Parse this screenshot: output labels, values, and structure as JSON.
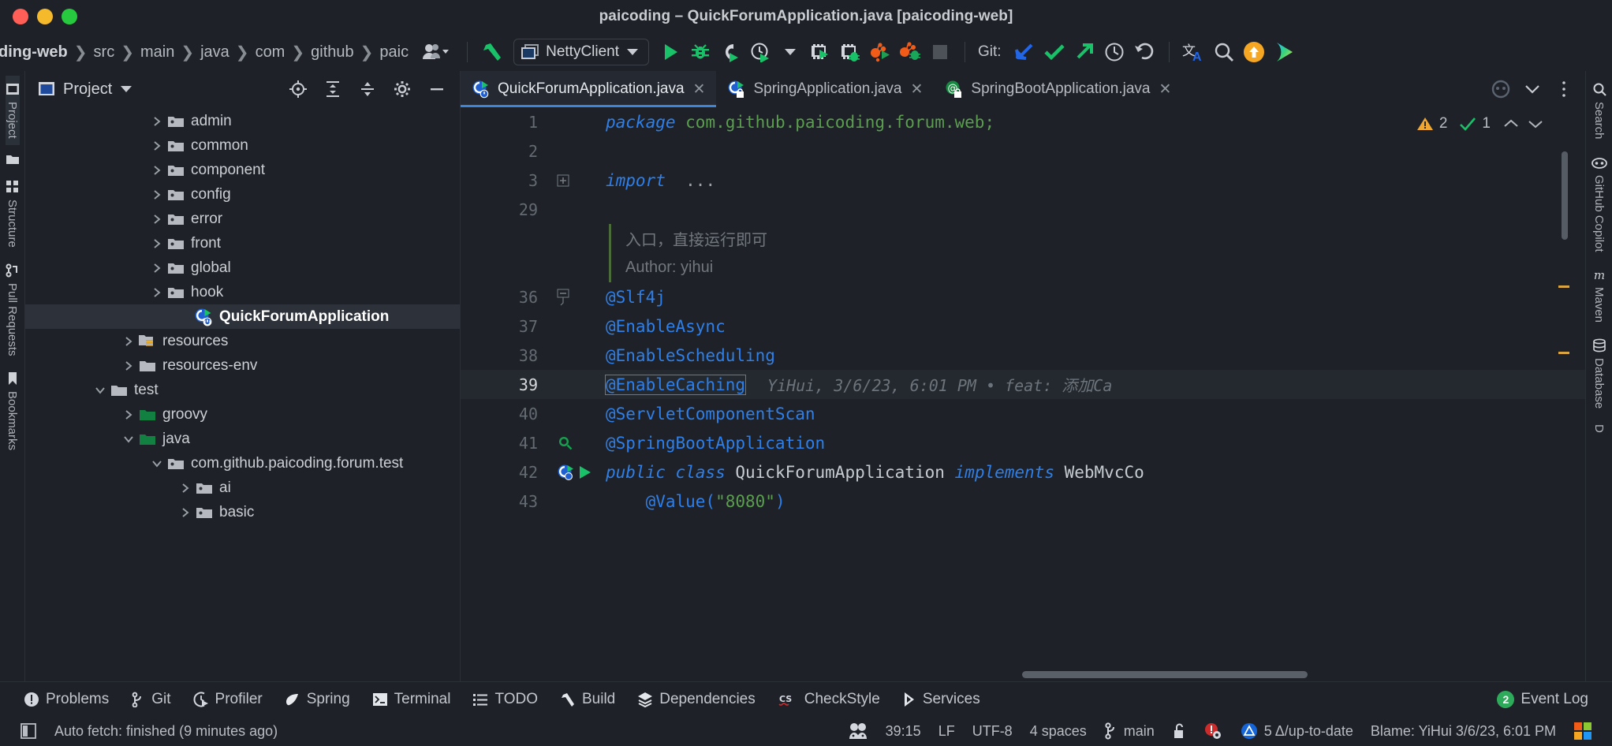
{
  "window": {
    "title": "paicoding – QuickForumApplication.java [paicoding-web]",
    "traffic_lights": [
      "close-red",
      "minimize-yellow",
      "maximize-green"
    ]
  },
  "navbar": {
    "breadcrumbs": [
      "ding-web",
      "src",
      "main",
      "java",
      "com",
      "github",
      "paic"
    ],
    "run_config": {
      "label": "NettyClient",
      "icon": "window-icon",
      "chevron": "▼"
    },
    "git_label": "Git:",
    "icons": [
      "avatar-group-icon",
      "build-hammer-icon",
      "run-icon",
      "debug-icon",
      "run-with-coverage-icon",
      "profiler-icon",
      "profiler-dropdown-icon",
      "run-tests-icon",
      "debug-tests-icon",
      "run-multiple-icon",
      "debug-multiple-icon",
      "stop-icon",
      "git-update-icon",
      "git-commit-icon",
      "git-push-icon",
      "history-icon",
      "rollback-icon",
      "translate-icon",
      "search-everywhere-icon",
      "update-available-icon",
      "ai-assistant-icon"
    ]
  },
  "left_rail": {
    "items": [
      {
        "label": "Project",
        "icon": "project-icon",
        "active": true
      },
      {
        "label": "",
        "icon": "folder-icon",
        "active": false
      },
      {
        "label": "Structure",
        "icon": "structure-icon",
        "active": false
      },
      {
        "label": "Pull Requests",
        "icon": "pull-request-icon",
        "active": false
      },
      {
        "label": "Bookmarks",
        "icon": "bookmarks-icon",
        "active": false
      }
    ]
  },
  "right_rail": {
    "items": [
      {
        "label": "Search",
        "icon": "search-icon"
      },
      {
        "label": "GitHub Copilot",
        "icon": "copilot-icon"
      },
      {
        "label": "Maven",
        "icon": "maven-icon"
      },
      {
        "label": "Database",
        "icon": "database-icon"
      },
      {
        "label": "D",
        "icon": "bookmark-icon"
      }
    ]
  },
  "project_panel": {
    "title": "Project",
    "title_chevron": "▼",
    "buttons": [
      "locate-icon",
      "expand-all-icon",
      "collapse-all-icon",
      "gear-icon",
      "hide-icon"
    ],
    "tree": [
      {
        "label": "admin",
        "indent": 4,
        "twisty": "right",
        "icon": "package-icon",
        "selected": false
      },
      {
        "label": "common",
        "indent": 4,
        "twisty": "right",
        "icon": "package-icon",
        "selected": false
      },
      {
        "label": "component",
        "indent": 4,
        "twisty": "right",
        "icon": "package-icon",
        "selected": false
      },
      {
        "label": "config",
        "indent": 4,
        "twisty": "right",
        "icon": "package-icon",
        "selected": false
      },
      {
        "label": "error",
        "indent": 4,
        "twisty": "right",
        "icon": "package-icon",
        "selected": false
      },
      {
        "label": "front",
        "indent": 4,
        "twisty": "right",
        "icon": "package-icon",
        "selected": false
      },
      {
        "label": "global",
        "indent": 4,
        "twisty": "right",
        "icon": "package-icon",
        "selected": false
      },
      {
        "label": "hook",
        "indent": 4,
        "twisty": "right",
        "icon": "package-icon",
        "selected": false
      },
      {
        "label": "QuickForumApplication",
        "indent": 5,
        "twisty": "none",
        "icon": "java-runnable-class-icon",
        "selected": true
      },
      {
        "label": "resources",
        "indent": 3,
        "twisty": "right",
        "icon": "resources-folder-icon",
        "selected": false
      },
      {
        "label": "resources-env",
        "indent": 3,
        "twisty": "right",
        "icon": "folder-icon",
        "selected": false
      },
      {
        "label": "test",
        "indent": 2,
        "twisty": "down",
        "icon": "folder-icon",
        "selected": false
      },
      {
        "label": "groovy",
        "indent": 3,
        "twisty": "right",
        "icon": "test-folder-icon",
        "selected": false
      },
      {
        "label": "java",
        "indent": 3,
        "twisty": "down",
        "icon": "test-folder-icon",
        "selected": false
      },
      {
        "label": "com.github.paicoding.forum.test",
        "indent": 4,
        "twisty": "down",
        "icon": "package-icon",
        "selected": false
      },
      {
        "label": "ai",
        "indent": 5,
        "twisty": "right",
        "icon": "package-icon",
        "selected": false
      },
      {
        "label": "basic",
        "indent": 5,
        "twisty": "right",
        "icon": "package-icon",
        "selected": false
      }
    ]
  },
  "editor_tabs": [
    {
      "label": "QuickForumApplication.java",
      "icon": "java-runnable-class-icon",
      "active": true,
      "close": "✕"
    },
    {
      "label": "SpringApplication.java",
      "icon": "java-readonly-class-icon",
      "active": false,
      "close": "✕"
    },
    {
      "label": "SpringBootApplication.java",
      "icon": "java-annotation-icon",
      "active": false,
      "close": "✕"
    }
  ],
  "editor_tabs_right_icons": [
    "copilot-tab-icon",
    "chevron-down-icon",
    "more-vertical-icon"
  ],
  "inspection_widget": {
    "warning_icon": "warning-triangle-icon",
    "warning_count": "2",
    "ok_icon": "inspection-check-icon",
    "ok_count": "1",
    "prev_icon": "chevron-up-icon",
    "next_icon": "chevron-down-icon"
  },
  "code": {
    "lines": [
      {
        "num": "1",
        "type": "code",
        "fold": "",
        "segments": [
          {
            "t": "package ",
            "c": "kw"
          },
          {
            "t": "com.github.paicoding.forum.web;",
            "c": "str"
          }
        ]
      },
      {
        "num": "2",
        "type": "code",
        "fold": "",
        "segments": []
      },
      {
        "num": "3",
        "type": "code",
        "fold": "+",
        "segments": [
          {
            "t": "import",
            "c": "kw"
          },
          {
            "t": "  ",
            "c": "plain"
          },
          {
            "t": "...",
            "c": "ellip"
          }
        ]
      },
      {
        "num": "29",
        "type": "code",
        "fold": "",
        "segments": []
      },
      {
        "num": "",
        "type": "doc",
        "fold": "",
        "text": "入口，直接运行即可"
      },
      {
        "num": "",
        "type": "doc",
        "fold": "",
        "text": "Author: yihui"
      },
      {
        "num": "36",
        "type": "code",
        "fold": "-",
        "segments": [
          {
            "t": "@Slf4j",
            "c": "ann"
          }
        ]
      },
      {
        "num": "37",
        "type": "code",
        "fold": "",
        "segments": [
          {
            "t": "@EnableAsync",
            "c": "ann"
          }
        ]
      },
      {
        "num": "38",
        "type": "code",
        "fold": "",
        "segments": [
          {
            "t": "@EnableScheduling",
            "c": "ann"
          }
        ]
      },
      {
        "num": "39",
        "type": "current",
        "fold": "",
        "caret_text": "@EnableCaching",
        "blame": "YiHui, 3/6/23, 6:01 PM • feat: 添加Ca"
      },
      {
        "num": "40",
        "type": "code",
        "fold": "",
        "segments": [
          {
            "t": "@ServletComponentScan",
            "c": "ann"
          }
        ]
      },
      {
        "num": "41",
        "type": "code",
        "fold": "",
        "gutter_icon": "search-usages-icon",
        "segments": [
          {
            "t": "@SpringBootApplication",
            "c": "ann"
          }
        ]
      },
      {
        "num": "42",
        "type": "code",
        "fold": "",
        "gutter_icon": "run-class-icon",
        "segments": [
          {
            "t": "public class ",
            "c": "kw"
          },
          {
            "t": "QuickForumApplication ",
            "c": "plain"
          },
          {
            "t": "implements ",
            "c": "kw"
          },
          {
            "t": "WebMvcCo",
            "c": "plain"
          }
        ]
      },
      {
        "num": "43",
        "type": "code",
        "fold": "",
        "segments": [
          {
            "t": "    @Value(",
            "c": "ann"
          },
          {
            "t": "\"8080\"",
            "c": "str"
          },
          {
            "t": ")",
            "c": "ann"
          }
        ]
      }
    ]
  },
  "bottom_toolwindows": [
    {
      "label": "Problems",
      "icon": "problems-icon"
    },
    {
      "label": "Git",
      "icon": "git-branch-icon"
    },
    {
      "label": "Profiler",
      "icon": "profiler-icon"
    },
    {
      "label": "Spring",
      "icon": "spring-leaf-icon"
    },
    {
      "label": "Terminal",
      "icon": "terminal-icon"
    },
    {
      "label": "TODO",
      "icon": "todo-icon"
    },
    {
      "label": "Build",
      "icon": "build-hammer-icon"
    },
    {
      "label": "Dependencies",
      "icon": "dependencies-icon"
    },
    {
      "label": "CheckStyle",
      "icon": "checkstyle-icon"
    },
    {
      "label": "Services",
      "icon": "services-icon"
    },
    {
      "label": "Event Log",
      "icon": "event-log-icon",
      "badge": "2"
    }
  ],
  "statusbar": {
    "left_icon": "toggle-toolwindow-icon",
    "message": "Auto fetch: finished (9 minutes ago)",
    "right": {
      "inspector_icon": "codewithme-icon",
      "caret_position": "39:15",
      "line_separator": "LF",
      "encoding": "UTF-8",
      "indent": "4 spaces",
      "branch_icon": "git-branch-icon",
      "branch": "main",
      "lock_icon": "unlocked-icon",
      "notify_icon": "error-notification-icon",
      "sync_icon": "sync-triangle-icon",
      "sync_text": "5 Δ/up-to-date",
      "blame": "Blame: YiHui 3/6/23, 6:01 PM",
      "logo_icon": "ide-logo-icon"
    }
  },
  "colors": {
    "bg": "#1e2228",
    "panel_selected": "#2c313a",
    "tab_active": "#252931",
    "accent_blue": "#3d85d8",
    "green": "#2eab5a",
    "keyword_blue": "#2f7fe8",
    "string_green": "#5a9e4e",
    "comment_gray": "#72777e",
    "orange": "#f25c19",
    "yellow": "#f5a623"
  }
}
